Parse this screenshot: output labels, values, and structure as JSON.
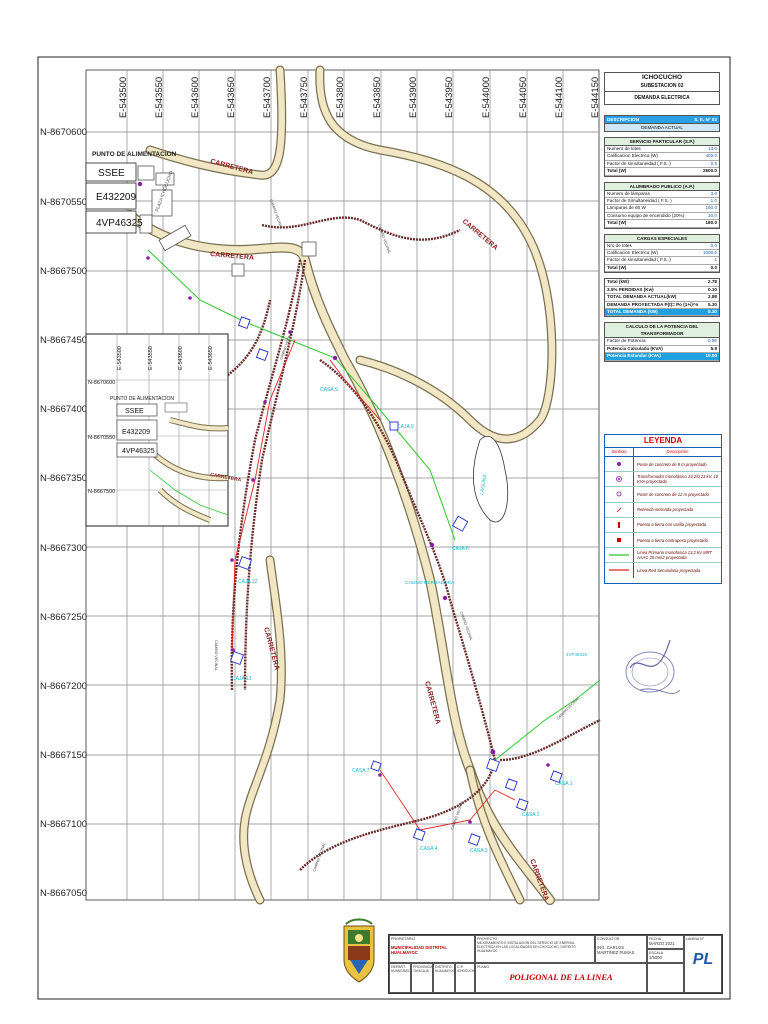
{
  "map": {
    "eastings_top": [
      "E-543500",
      "E-543550",
      "E-543600",
      "E-543650",
      "E-543700",
      "E-543750",
      "E-543800",
      "E-543850",
      "E-543900",
      "E-543950",
      "E-544000",
      "E-544050",
      "E-544100",
      "E-544150"
    ],
    "northings_left": [
      "N-8670600",
      "N-8670550",
      "N-8667500",
      "N-8667450",
      "N-8667400",
      "N-8667350",
      "N-8667300",
      "N-8667250",
      "N-8667200",
      "N-8667150",
      "N-8667100",
      "N-8667050"
    ],
    "labels": {
      "punto_alimentacion": "PUNTO DE ALIMENTACION",
      "ssee": "SSEE",
      "e_code": "E432209",
      "vp_code": "4VP46325",
      "carretera": "CARRETERA",
      "camino_vecinal": "CAMINO VECINAL",
      "plaza": "PLAZA ICHOCUCHO",
      "laguna": "LAGUNA",
      "casa_s": "CASA S",
      "caja_9": "CAJA 9",
      "caja_12": "CAJA 12",
      "caja_13": "CAJA 13",
      "caja_6": "CAJA 6",
      "chuno_herradura": "CHUNO HERRADURA",
      "casa_7": "CASA 7",
      "casa_1": "CASA 1",
      "casa_2": "CASA 2",
      "casa_3": "CASA 3",
      "casa_4": "CASA 4",
      "ancho_label": "4VP46325"
    },
    "inset": {
      "eastings": [
        "E-543500",
        "E-543550",
        "E-543600",
        "E-543650"
      ],
      "northings": [
        "N-8670600",
        "N-8670550",
        "N-8667500"
      ],
      "punto_alimentacion": "PUNTO DE ALIMENTACION",
      "ssee": "SSEE",
      "e_code": "E432209",
      "vp_code": "4VP46325",
      "carretera": "CARRETERA"
    },
    "colors": {
      "road_fill": "#f1e7c4",
      "road_edge": "#7a7050",
      "primary_line": "#2ec82e",
      "secondary_line": "#e02020",
      "path_line": "#6a2b2b",
      "grid": "#777777",
      "pole": "#8a1ea8",
      "label_cyan": "#17b4d6"
    }
  },
  "panel": {
    "title": "ICHOCUCHO",
    "subtitle": "SUBESTACION 02",
    "section": "DEMANDA ELECTRICA",
    "desc_left": "DESCRIPCION",
    "desc_right": "S. E. N° 02",
    "demanda_actual": "DEMANDA ACTUAL",
    "sp": {
      "title": "SERVICIO PARTICULAR (S.P.)",
      "rows": [
        {
          "k": "Numero de lotes",
          "v": "13.0"
        },
        {
          "k": "Calificacion Electrica (W)",
          "v": "400.0"
        },
        {
          "k": "Factor de simultaneidad ( F.S. )",
          "v": "0.5"
        },
        {
          "k": "Total (W)",
          "v": "2600.0"
        }
      ]
    },
    "ap": {
      "title": "ALUMBRADO PUBLICO (A.P.)",
      "rows": [
        {
          "k": "Numero de lámparas",
          "v": "3.0"
        },
        {
          "k": "Factor de Simultaneidad ( F.S. )",
          "v": "1.0"
        },
        {
          "k": "Lámparas de 60 W",
          "v": "150.0"
        },
        {
          "k": "Consumo equipo de encendido (20%)",
          "v": "30.0"
        },
        {
          "k": "Total (W)",
          "v": "180.0"
        }
      ]
    },
    "ce": {
      "title": "CARGAS ESPECIALES",
      "rows": [
        {
          "k": "Nro de lotes",
          "v": "0.0"
        },
        {
          "k": "Calificacion Electrica (W)",
          "v": "1000.0"
        },
        {
          "k": "Factor de simultaneidad ( F.S. )",
          "v": "1"
        },
        {
          "k": "Total (W)",
          "v": "0.0"
        }
      ]
    },
    "totals": [
      {
        "k": "Total (kW)",
        "v": "2.78"
      },
      {
        "k": "3.5% PERDIDAS (Kw)",
        "v": "0.10"
      },
      {
        "k": "TOTAL DEMANDA ACTUAL(kW)",
        "v": "2.88"
      },
      {
        "k": "DEMANDA PROYECTADA P(t)= Po (1+i)^n",
        "v": "5.30"
      },
      {
        "k": "TOTAL DEMANDA (kW)",
        "v": "5.30"
      }
    ],
    "trafo": {
      "title": "CALCULO DE LA POTENCIA DEL TRANSFORMADOR",
      "rows": [
        {
          "k": "Factor de Potencia",
          "v": "0.90"
        },
        {
          "k": "Potencia Calculada (KVA)",
          "v": "5.9"
        },
        {
          "k": "Potencia Estandar (KVA)",
          "v": "10.00"
        }
      ]
    }
  },
  "legend": {
    "title": "LEYENDA",
    "col_symbol": "Simbolo",
    "col_desc": "Descripción",
    "items": [
      "Poste de concreto de 9 m proyectado",
      "Transformador monofásico 13,2/0,23 kV, 10 KVA proyectado",
      "Poste de concreto de 12 m proyectado",
      "Retenida inclinada proyectada",
      "Puesta a tierra con varilla proyectada",
      "Puesta a tierra contrapeso proyectado",
      "Linea Primaria monofasica 13,2 kV MRT AAAC 25 mm2 proyectada",
      "Linea Red Secundaria proyectada"
    ]
  },
  "title_block": {
    "propietario_lab": "PROPIETARIO",
    "propietario": "MUNICIPALIDAD DISTRITAL HUALMAYOC",
    "proyecto_lab": "PROYECTO",
    "proyecto": "MEJORAMIENTO E INSTALACION DEL SERVICIO DE ENERGIA ELECTRICA EN LAS LOCALIDADES DE ICHOCUCHO, DISTRITO HUALMAYOC",
    "plano_lab": "PLANO",
    "plano": "POLIGONAL DE LA LINEA",
    "consultor_lab": "CONSULTOR",
    "consultor": "ING. CARLOS MARTINEZ PUMAS",
    "fecha_lab": "FECHA",
    "fecha": "MARZO 2021",
    "lamina_lab": "LAMINA N°",
    "lamina": "PL",
    "escala_lab": "ESCALA",
    "escala": "1/5000",
    "depto_lab": "DEPART.",
    "depto": "HUANCAVELICA",
    "prov_lab": "PROVINCIA",
    "prov": "TAYACAJA",
    "dist_lab": "DISTRITO",
    "dist": "HUALMAYOC",
    "cp_lab": "C.P.",
    "cp": "ICHOCUCHO"
  }
}
